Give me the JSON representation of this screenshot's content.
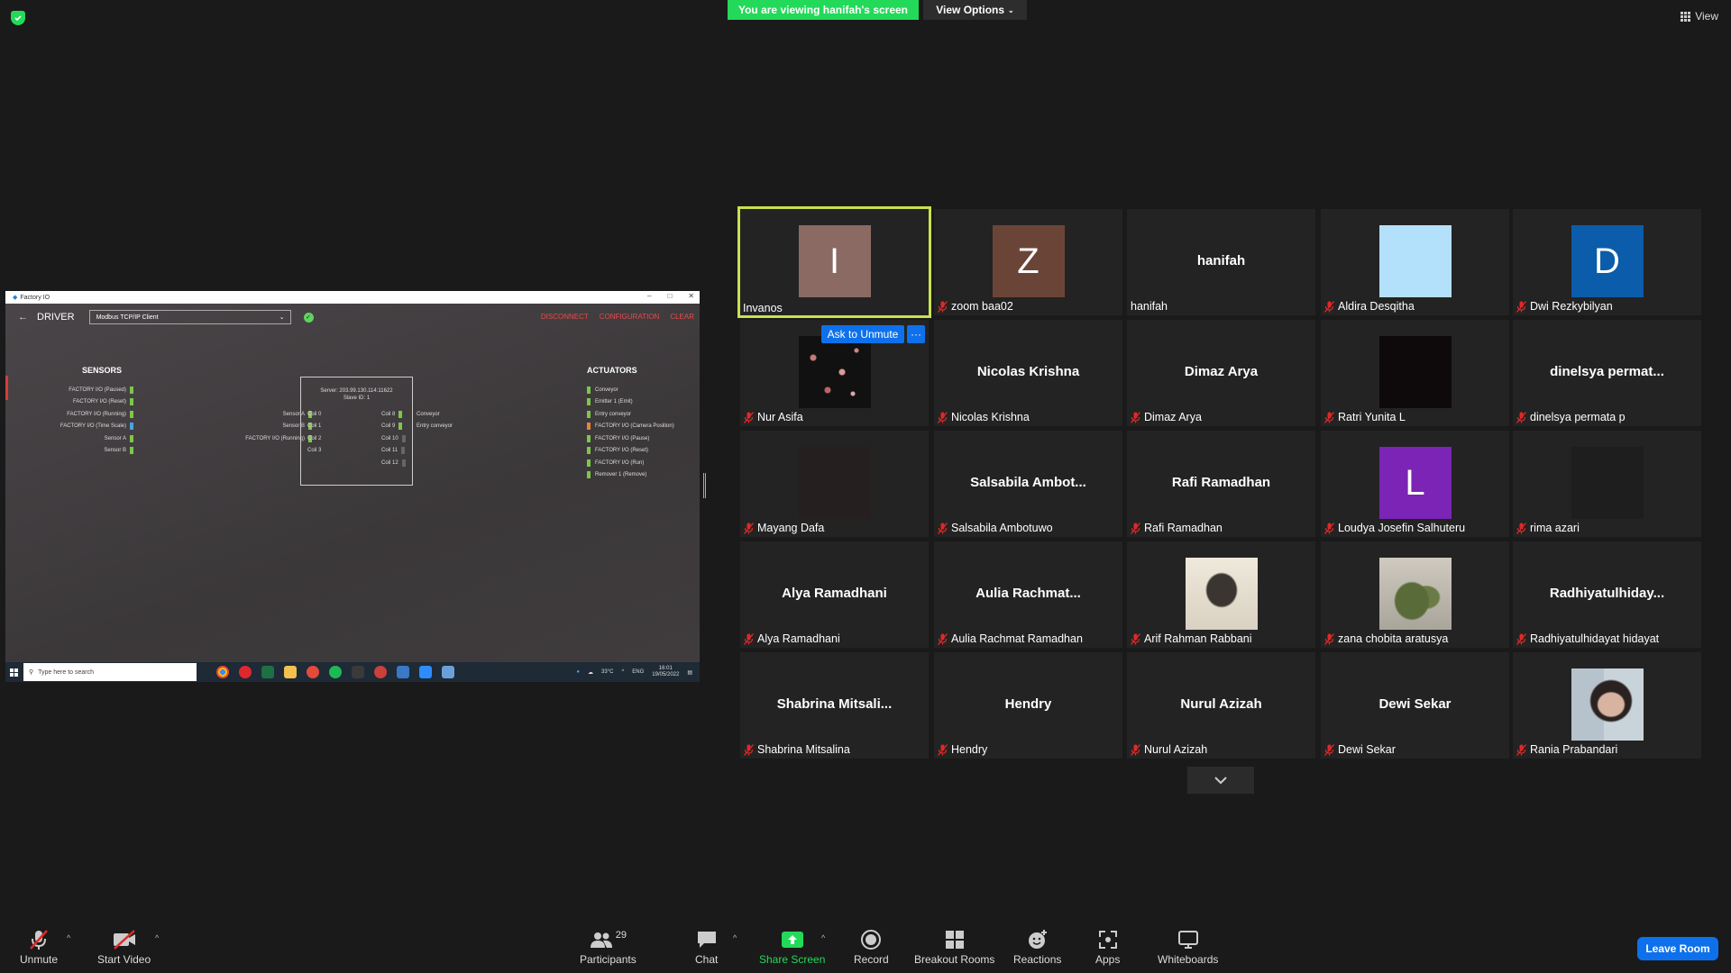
{
  "top": {
    "viewing_banner": "You are viewing hanifah's screen",
    "view_options": "View Options",
    "view": "View"
  },
  "shared_screen": {
    "window_title": "Factory IO",
    "back": "←",
    "driver_title": "DRIVER",
    "driver_select": "Modbus TCP/IP Client",
    "actions": [
      "DISCONNECT",
      "CONFIGURATION",
      "CLEAR"
    ],
    "sensors_title": "SENSORS",
    "sensors": [
      "FACTORY I/O (Paused)",
      "FACTORY I/O (Reset)",
      "FACTORY I/O (Running)",
      "FACTORY I/O (Time Scale)",
      "Sensor A",
      "Sensor B"
    ],
    "inputs_mapped": [
      "Sensor A",
      "Sensor B",
      "FACTORY I/O (Running)"
    ],
    "server_line1": "Server: 203.99.130.114:11622",
    "server_line2": "Slave ID: 1",
    "coils_left": [
      "Coil 0",
      "Coil 1",
      "Coil 2",
      "Coil 3"
    ],
    "coils_right": [
      "Coil 8",
      "Coil 9",
      "Coil 10",
      "Coil 11",
      "Coil 12"
    ],
    "outputs_mapped": [
      "Conveyor",
      "Entry conveyor"
    ],
    "actuators_title": "ACTUATORS",
    "actuators": [
      "Conveyor",
      "Emitter 1 (Emit)",
      "Entry conveyor",
      "FACTORY I/O (Camera Position)",
      "FACTORY I/O (Pause)",
      "FACTORY I/O (Reset)",
      "FACTORY I/O (Run)",
      "Remover 1 (Remove)"
    ],
    "taskbar_search": "Type here to search",
    "weather": "33°C",
    "lang": "ENG",
    "time": "16:01",
    "date": "19/05/2022"
  },
  "gallery": [
    {
      "name": "Invanos",
      "initial": "I",
      "color": "#8a6a62",
      "muted": false,
      "active": true
    },
    {
      "name": "zoom baa02",
      "initial": "Z",
      "color": "#6b4438",
      "muted": true
    },
    {
      "name": "hanifah",
      "bigname": "hanifah",
      "muted": false
    },
    {
      "name": "Aldira Desqitha",
      "initial": "",
      "color": "#b3e0fb",
      "muted": true
    },
    {
      "name": "Dwi Rezkybilyan",
      "initial": "D",
      "color": "#0b5cab",
      "muted": true
    },
    {
      "name": "Nur Asifa",
      "pic": "flowers",
      "muted": true
    },
    {
      "name": "Nicolas Krishna",
      "bigname": "Nicolas Krishna",
      "muted": true
    },
    {
      "name": "Dimaz Arya",
      "bigname": "Dimaz Arya",
      "muted": true
    },
    {
      "name": "Ratri Yunita L",
      "initial": "",
      "color": "#0e0a0c",
      "muted": true
    },
    {
      "name": "dinelsya permata p",
      "bigname": "dinelsya  permat...",
      "muted": true
    },
    {
      "name": "Mayang Dafa",
      "initial": "",
      "color": "#261f20",
      "muted": true
    },
    {
      "name": "Salsabila Ambotuwo",
      "bigname": "Salsabila  Ambot...",
      "muted": true
    },
    {
      "name": "Rafi Ramadhan",
      "bigname": "Rafi Ramadhan",
      "muted": true
    },
    {
      "name": "Loudya Josefin Salhuteru",
      "initial": "L",
      "color": "#7b24b5",
      "muted": true
    },
    {
      "name": "rima azari",
      "initial": "",
      "color": "#1e1e1e",
      "muted": true
    },
    {
      "name": "Alya Ramadhani",
      "bigname": "Alya Ramadhani",
      "muted": true
    },
    {
      "name": "Aulia Rachmat Ramadhan",
      "bigname": "Aulia  Rachmat...",
      "muted": true
    },
    {
      "name": "Arif Rahman Rabbani",
      "pic": "sketch",
      "muted": true
    },
    {
      "name": "zana chobita aratusya",
      "pic": "cactus",
      "muted": true
    },
    {
      "name": "Radhiyatulhidayat hidayat",
      "bigname": "Radhiyatulhiday...",
      "muted": true
    },
    {
      "name": "Shabrina Mitsalina",
      "bigname": "Shabrina  Mitsali...",
      "muted": true
    },
    {
      "name": "Hendry",
      "bigname": "Hendry",
      "muted": true
    },
    {
      "name": "Nurul Azizah",
      "bigname": "Nurul Azizah",
      "muted": true
    },
    {
      "name": "Dewi Sekar",
      "bigname": "Dewi Sekar",
      "muted": true
    },
    {
      "name": "Rania Prabandari",
      "pic": "girl",
      "muted": true
    }
  ],
  "ask_to_unmute": "Ask to Unmute",
  "more": "···",
  "toolbar": {
    "unmute": "Unmute",
    "start_video": "Start Video",
    "participants": "Participants",
    "participants_count": "29",
    "chat": "Chat",
    "share_screen": "Share Screen",
    "record": "Record",
    "breakout_rooms": "Breakout Rooms",
    "reactions": "Reactions",
    "apps": "Apps",
    "whiteboards": "Whiteboards",
    "leave": "Leave Room"
  },
  "colors": {
    "green": "#23d959",
    "blue": "#0e71eb",
    "active_border": "#c8e24e",
    "mute_red": "#e02828"
  }
}
